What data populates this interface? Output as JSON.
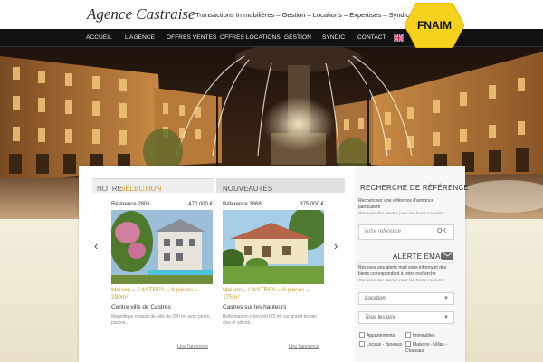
{
  "header": {
    "logo": "Agence Castraise",
    "tagline": "Transactions Immobilières – Gestion – Locations – Expertises – Syndic",
    "badge": "FNAIM"
  },
  "nav": {
    "items": [
      "ACCUEIL",
      "L'AGENCE",
      "OFFRES VENTES",
      "OFFRES LOCATIONS",
      "GESTION",
      "SYNDIC",
      "CONTACT"
    ],
    "language_icon": "uk-flag-icon"
  },
  "tabs": {
    "selection_prefix": "NOTRE",
    "selection_highlight": "SÉLECTION",
    "new": "NOUVEAUTÉS"
  },
  "listings": [
    {
      "ref": "Référence 2806",
      "price": "470 000 €",
      "title": "Maison – CASTRES – 9 pièces – 290m²",
      "subtitle": "Centre ville de Castres",
      "desc": "Magnifique maison de ville de 290 m² avec jardin, piscine...",
      "link": "Lire l'annonce"
    },
    {
      "ref": "Référence 2868",
      "price": "375 000 €",
      "title": "Maison – CASTRES – 6 pièces – 175m²",
      "subtitle": "Castres sur les hauteurs",
      "desc": "Belle maison d'environ175 m² sur grand terrain clos et arboré...",
      "link": "Lire l'annonce"
    }
  ],
  "sidebar": {
    "reference_title": "RECHERCHE DE RÉFÉRENCE",
    "reference_text": "Recherchez une référence d'annonce particulière",
    "reference_hint": "Recevoir des alertes pour les biens suivants :",
    "reference_placeholder": "Votre référence",
    "ok": "OK",
    "alert_title": "ALERTE EMAIL",
    "alert_text": "Recevez une alerte mail vous informant des biens correspondant à votre recherche",
    "alert_hint": "Recevoir des alertes pour les biens suivants :",
    "location": "Location",
    "prices": "Tous les prix",
    "types": [
      "Appartements",
      "Immeubles",
      "Locaux - Bureaux",
      "Maisons - Villas - Chateaux"
    ]
  },
  "colors": {
    "accent": "#c79a20",
    "fnaim_yellow": "#f7d21c",
    "nav_bg": "#111111"
  }
}
